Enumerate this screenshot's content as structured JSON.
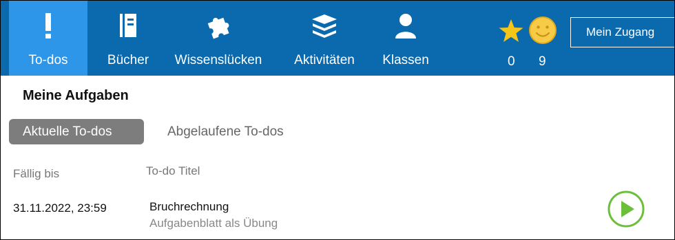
{
  "nav": {
    "items": [
      {
        "label": "To-dos",
        "icon": "exclamation-icon"
      },
      {
        "label": "Bücher",
        "icon": "book-icon"
      },
      {
        "label": "Wissenslücken",
        "icon": "puzzle-icon"
      },
      {
        "label": "Aktivitäten",
        "icon": "stack-icon"
      },
      {
        "label": "Klassen",
        "icon": "person-icon"
      }
    ],
    "active_index": 0,
    "star_count": "0",
    "smiley_count": "9",
    "account_label": "Mein Zugang"
  },
  "main": {
    "title": "Meine Aufgaben",
    "tabs": [
      "Aktuelle To-dos",
      "Abgelaufene To-dos"
    ],
    "table": {
      "headers": [
        "Fällig bis",
        "To-do Titel"
      ],
      "rows": [
        {
          "due": "31.11.2022, 23:59",
          "title": "Bruchrechnung",
          "subtitle": "Aufgabenblatt als Übung"
        }
      ]
    }
  },
  "colors": {
    "nav_bg": "#0a6aad",
    "nav_active": "#2d96e8",
    "accent_green": "#6cbf3a",
    "star": "#f5c518"
  }
}
